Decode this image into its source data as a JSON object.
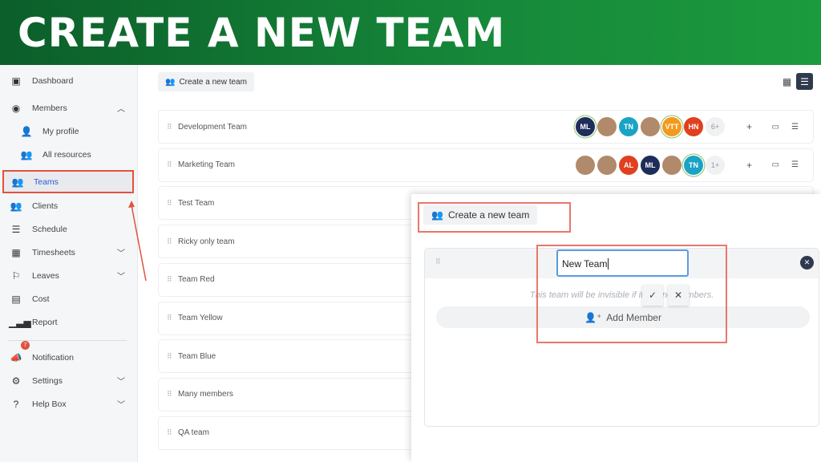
{
  "banner": {
    "title": "CREATE A NEW TEAM"
  },
  "sidebar": {
    "items": [
      {
        "label": "Dashboard",
        "icon": "dashboard-icon"
      },
      {
        "label": "Members",
        "icon": "user-circle-icon"
      },
      {
        "label": "My profile",
        "icon": "user-icon"
      },
      {
        "label": "All resources",
        "icon": "users-icon"
      },
      {
        "label": "Teams",
        "icon": "team-icon"
      },
      {
        "label": "Clients",
        "icon": "clients-icon"
      },
      {
        "label": "Schedule",
        "icon": "schedule-icon"
      },
      {
        "label": "Timesheets",
        "icon": "table-icon"
      },
      {
        "label": "Leaves",
        "icon": "flag-icon"
      },
      {
        "label": "Cost",
        "icon": "calculator-icon"
      },
      {
        "label": "Report",
        "icon": "chart-icon"
      },
      {
        "label": "Notification",
        "icon": "bullhorn-icon",
        "badge": "7"
      },
      {
        "label": "Settings",
        "icon": "gear-icon"
      },
      {
        "label": "Help Box",
        "icon": "question-icon"
      }
    ]
  },
  "toolbar": {
    "create_label": "Create a new team"
  },
  "teams": [
    {
      "name": "Development Team",
      "avatars": [
        "ML",
        "",
        "TN",
        "",
        "VTT",
        "HN"
      ],
      "more": "6+"
    },
    {
      "name": "Marketing Team",
      "avatars": [
        "",
        "",
        "AL",
        "ML",
        "",
        "TN"
      ],
      "more": "1+"
    },
    {
      "name": "Test Team"
    },
    {
      "name": "Ricky only team"
    },
    {
      "name": "Team Red"
    },
    {
      "name": "Team Yellow"
    },
    {
      "name": "Team Blue"
    },
    {
      "name": "Many members"
    },
    {
      "name": "QA team"
    }
  ],
  "panel": {
    "create_label": "Create a new team",
    "input_value": "New Team",
    "hint": "This team will be invisible if it has no members.",
    "add_member": "Add Member"
  },
  "colors": {
    "accent": "#2a5bd7",
    "highlight": "#e0533f",
    "banner": "#16893a"
  }
}
